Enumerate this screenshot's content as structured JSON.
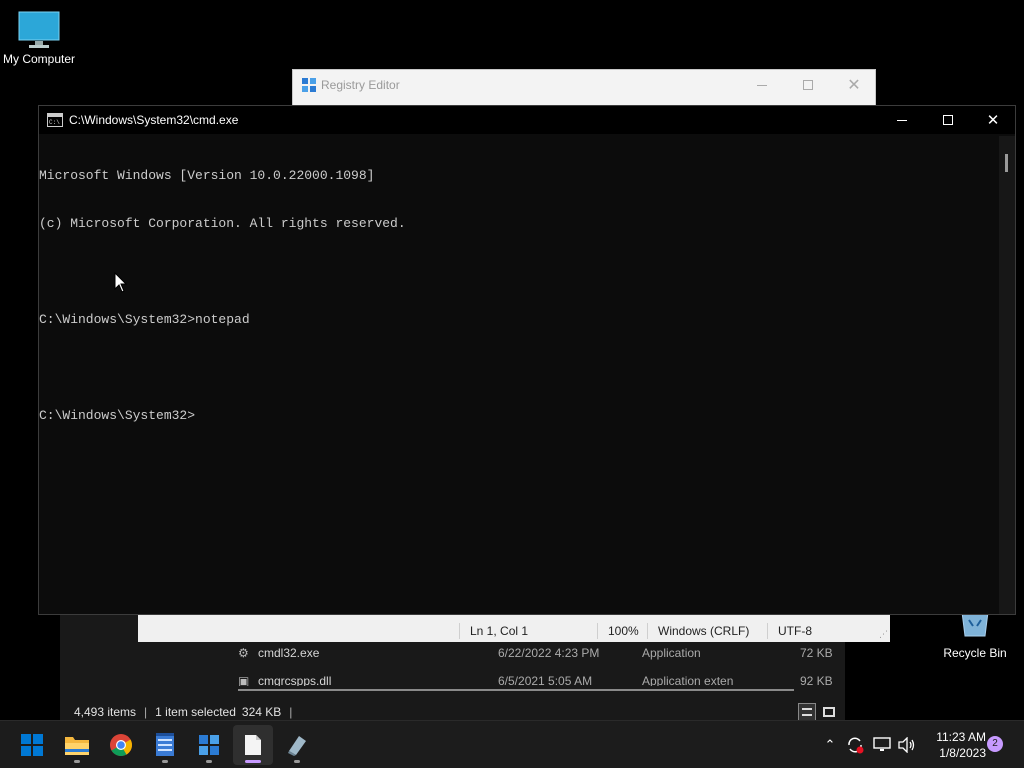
{
  "desktop": {
    "my_computer": "My Computer",
    "recycle_bin": "Recycle Bin"
  },
  "regedit": {
    "title": "Registry Editor"
  },
  "cmd": {
    "title": "C:\\Windows\\System32\\cmd.exe",
    "lines": [
      "Microsoft Windows [Version 10.0.22000.1098]",
      "(c) Microsoft Corporation. All rights reserved.",
      "",
      "C:\\Windows\\System32>notepad",
      "",
      "C:\\Windows\\System32>"
    ]
  },
  "notepad_status": {
    "position": "Ln 1, Col 1",
    "zoom": "100%",
    "line_endings": "Windows (CRLF)",
    "encoding": "UTF-8"
  },
  "explorer": {
    "rows": [
      {
        "name": "cmdl32.exe",
        "date": "6/22/2022 4:23 PM",
        "type": "Application",
        "size": "72 KB"
      },
      {
        "name": "cmgrcspps.dll",
        "date": "6/5/2021 5:05 AM",
        "type": "Application exten",
        "size": "92 KB"
      }
    ],
    "status": {
      "items": "4,493 items",
      "selected": "1 item selected",
      "size": "324 KB"
    }
  },
  "taskbar": {
    "apps": [
      "start",
      "file-explorer",
      "chrome",
      "notepad-plus",
      "registry-editor",
      "notepad",
      "app-installer"
    ],
    "time": "11:23 AM",
    "date": "1/8/2023",
    "notifications": "2"
  },
  "colors": {
    "console_bg": "#0c0c0c",
    "console_text": "#cccccc",
    "taskbar_bg": "#1c1c1c",
    "accent": "#c79aff",
    "start_blue": "#0078d4"
  }
}
